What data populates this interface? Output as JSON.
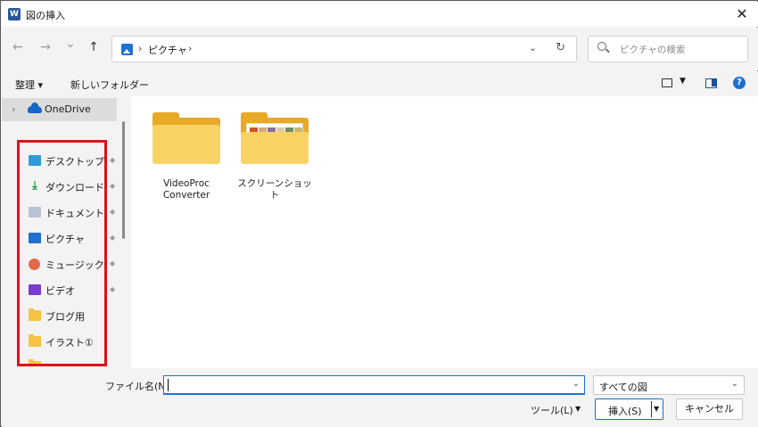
{
  "window": {
    "app_icon_letter": "W",
    "title": "図の挿入",
    "close_glyph": "✕"
  },
  "nav": {
    "back_glyph": "←",
    "forward_glyph": "→",
    "recent_glyph": "⌄",
    "up_glyph": "↑"
  },
  "address": {
    "separator": "›",
    "path": "ピクチャ",
    "dropdown_glyph": "⌄",
    "refresh_glyph": "↻"
  },
  "search": {
    "placeholder": "ピクチャの検索"
  },
  "commandbar": {
    "organize_label": "整理 ▾",
    "new_folder_label": "新しいフォルダー",
    "view_dropdown_glyph": "▼",
    "help_glyph": "?"
  },
  "sidebar": {
    "expand_glyph": "›",
    "onedrive_label": "OneDrive",
    "pin_glyph": "◆",
    "items": [
      {
        "label": "デスクトップ",
        "icon": "desktop-icon"
      },
      {
        "label": "ダウンロード",
        "icon": "download-icon"
      },
      {
        "label": "ドキュメント",
        "icon": "documents-icon"
      },
      {
        "label": "ピクチャ",
        "icon": "pictures-icon"
      },
      {
        "label": "ミュージック",
        "icon": "music-icon"
      },
      {
        "label": "ビデオ",
        "icon": "videos-icon"
      },
      {
        "label": "ブログ用",
        "icon": "folder-icon"
      },
      {
        "label": "イラスト①",
        "icon": "folder-icon"
      }
    ]
  },
  "files": [
    {
      "name_line1": "VideoProc",
      "name_line2": "Converter",
      "icon": "folder-icon"
    },
    {
      "name_line1": "スクリーンショット",
      "name_line2": "",
      "icon": "folder-with-images-icon"
    }
  ],
  "footer": {
    "filename_label": "ファイル名(N):",
    "filename_value": "",
    "filename_dropdown_glyph": "⌄",
    "filter_value": "すべての図",
    "filter_dropdown_glyph": "⌄",
    "tools_label": "ツール(L)",
    "tools_dropdown_glyph": "▼",
    "insert_label": "挿入(S)",
    "insert_dropdown_glyph": "▼",
    "cancel_label": "キャンセル"
  },
  "colors": {
    "accent": "#1f6fd0",
    "highlight_box": "#e0101a",
    "folder": "#f7cf5a"
  }
}
